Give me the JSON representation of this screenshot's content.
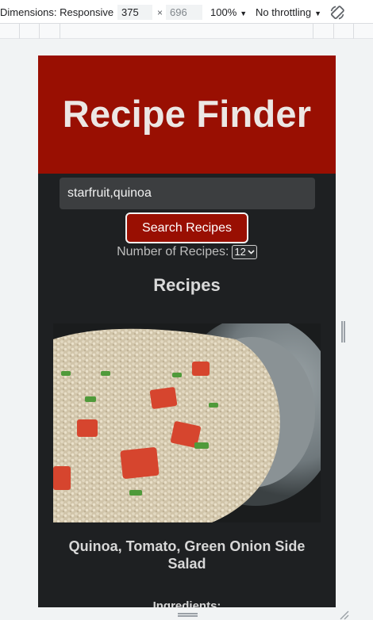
{
  "devtools": {
    "dimensions_label": "Dimensions: Responsive",
    "width": "375",
    "times": "×",
    "height": "696",
    "zoom": "100%",
    "throttling": "No throttling",
    "caret": "▼",
    "rotate_icon": "rotate-icon"
  },
  "site": {
    "title": "Recipe Finder",
    "search_value": "starfruit,quinoa",
    "search_button": "Search Recipes",
    "count_label": "Number of Recipes:",
    "count_value": "12",
    "recipes_heading": "Recipes",
    "recipe": {
      "title": "Quinoa, Tomato, Green Onion Side Salad",
      "ingredients_heading": "Ingredients:"
    }
  },
  "colors": {
    "brand": "#990f02",
    "page_background": "#1e2022",
    "title_text": "#ece7e4"
  }
}
